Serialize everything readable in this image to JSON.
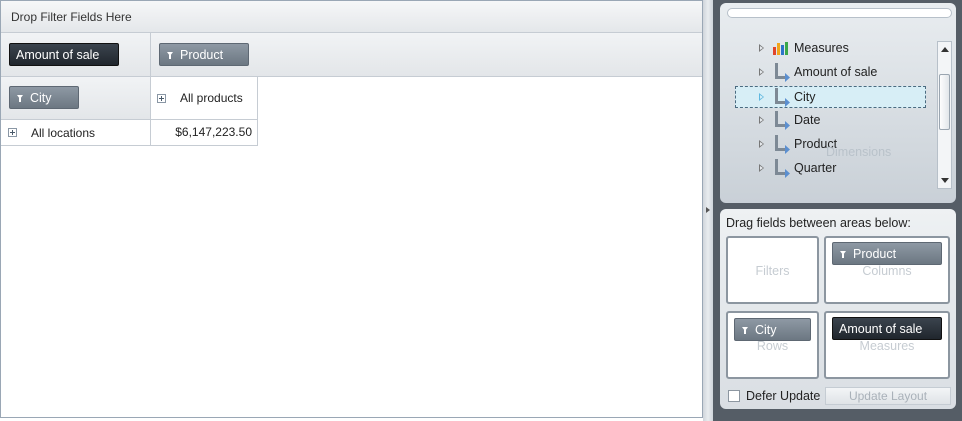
{
  "grid": {
    "filter_zone_text": "Drop Filter Fields Here",
    "measure_chip": "Amount of sale",
    "column_chip": "Product",
    "row_chip": "City",
    "column_header": "All products",
    "row_header": "All locations",
    "total_value": "$6,147,223.50"
  },
  "fieldlist": {
    "tree_items": [
      {
        "label": "Measures",
        "icon": "measures-icon"
      },
      {
        "label": "Amount of sale",
        "icon": "hierarchy-icon"
      },
      {
        "label": "City",
        "icon": "hierarchy-icon",
        "selected": true
      },
      {
        "label": "Date",
        "icon": "hierarchy-icon"
      },
      {
        "label": "Product",
        "icon": "hierarchy-icon"
      },
      {
        "label": "Quarter",
        "icon": "hierarchy-icon"
      }
    ],
    "drag_ghost": "Dimensions",
    "drag_title": "Drag fields between areas below:",
    "areas": {
      "filters": {
        "label": "Filters"
      },
      "columns": {
        "label": "Columns",
        "chip": "Product"
      },
      "rows": {
        "label": "Rows",
        "chip": "City"
      },
      "measures": {
        "label": "Measures",
        "chip": "Amount of sale"
      }
    },
    "defer_update_label": "Defer Update",
    "defer_update_checked": false,
    "update_layout_label": "Update Layout"
  },
  "colors": {
    "selection_fill": "#d7eef6",
    "panel_background": "#555d66",
    "chip_dark": "#20262d",
    "chip_field": "#7b8690"
  }
}
